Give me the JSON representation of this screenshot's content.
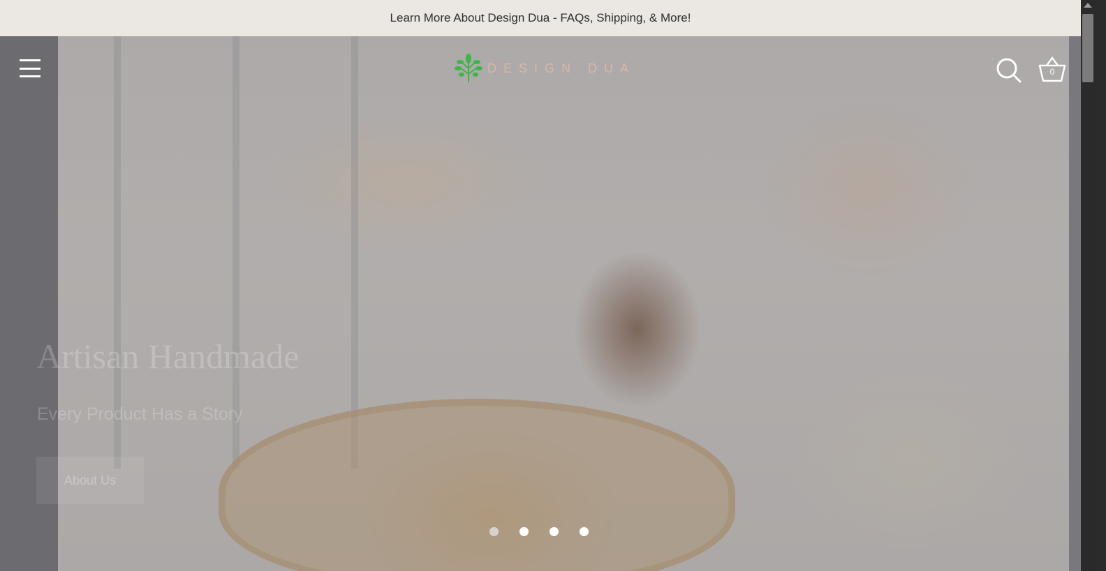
{
  "announcement": {
    "text": "Learn More About Design Dua - FAQs, Shipping, & More!"
  },
  "header": {
    "logo_text": "DESIGN DUA",
    "cart_count": "0",
    "menu_icon": "hamburger-menu-icon",
    "search_icon": "search-icon",
    "cart_icon": "basket-icon"
  },
  "slide": {
    "title": "Artisan Handmade",
    "subtitle": "Every Product Has a Story",
    "button_label": "About Us"
  },
  "slider": {
    "count": 4,
    "active_index": 0
  },
  "colors": {
    "announcement_bg": "#ebe8e3",
    "logo_green": "#3db54a",
    "logo_text": "#d9b7a7",
    "header_icons": "#ffffff"
  }
}
